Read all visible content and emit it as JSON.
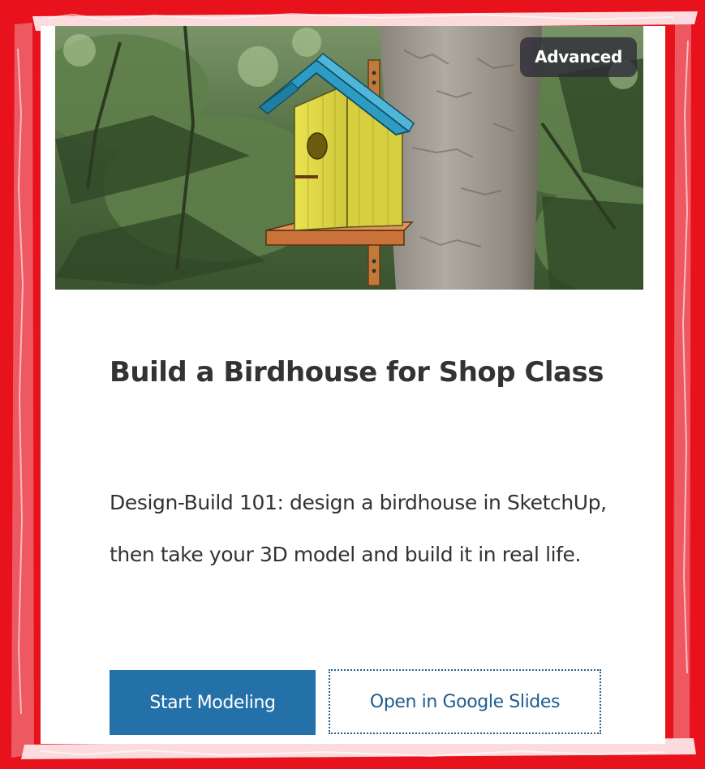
{
  "card": {
    "badge": "Advanced",
    "title": "Build a Birdhouse for Shop Class",
    "description": "Design-Build 101: design a birdhouse in SketchUp, then take your 3D model and build it in real life.",
    "primary_button": "Start Modeling",
    "secondary_button": "Open in Google Slides"
  },
  "colors": {
    "frame": "#e8121d",
    "primary_button_bg": "#2470a9",
    "secondary_button_text": "#1f5c90",
    "badge_bg": "#2d2a37",
    "title_text": "#333333"
  },
  "icons": {
    "hero_image": "birdhouse-on-tree-illustration"
  }
}
